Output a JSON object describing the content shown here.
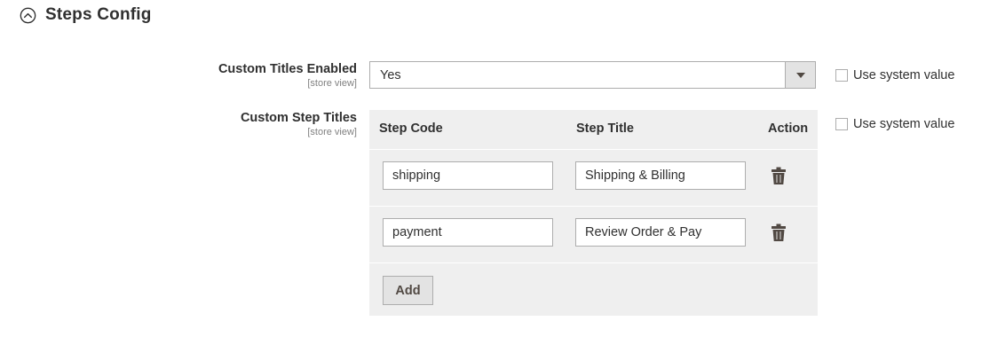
{
  "section": {
    "title": "Steps Config",
    "toggle_icon": "chevron-up-circle-icon"
  },
  "fields": {
    "custom_titles_enabled": {
      "label": "Custom Titles Enabled",
      "scope": "[store view]",
      "value": "Yes",
      "use_system_label": "Use system value",
      "use_system_checked": false
    },
    "custom_step_titles": {
      "label": "Custom Step Titles",
      "scope": "[store view]",
      "use_system_label": "Use system value",
      "use_system_checked": false,
      "columns": [
        "Step Code",
        "Step Title",
        "Action"
      ],
      "rows": [
        {
          "code": "shipping",
          "title": "Shipping & Billing"
        },
        {
          "code": "payment",
          "title": "Review Order & Pay"
        }
      ],
      "add_label": "Add",
      "delete_icon": "trash-icon"
    }
  },
  "colors": {
    "text": "#303030",
    "grid_bg": "#efefef",
    "border": "#adadad",
    "button_bg": "#e3e3e3",
    "icon": "#514943"
  }
}
